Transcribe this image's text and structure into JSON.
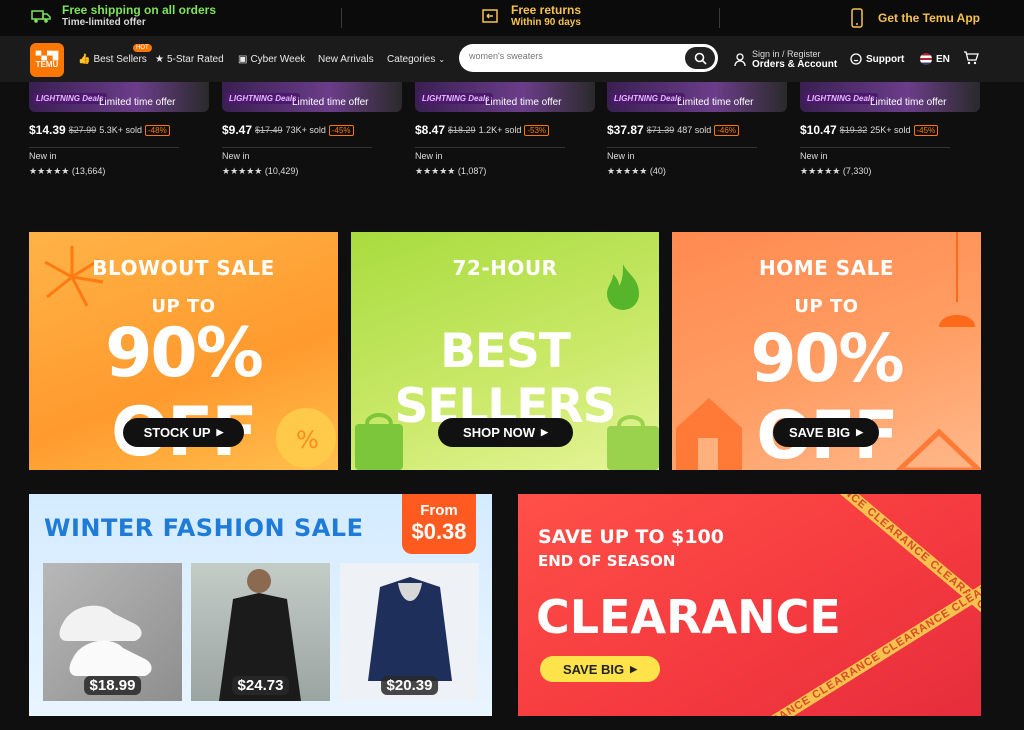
{
  "promo": {
    "shipping_title": "Free shipping on all orders",
    "shipping_sub": "Time-limited offer",
    "returns_title": "Free returns",
    "returns_sub": "Within 90 days",
    "app_label": "Get the Temu App"
  },
  "nav": {
    "logo_line1": "▀▄▀█",
    "logo_line2": "TEMU",
    "links": [
      "Best Sellers",
      "5-Star Rated",
      "Cyber Week",
      "New Arrivals",
      "Categories"
    ],
    "hot_badge": "HOT",
    "search_placeholder": "women's sweaters",
    "signin_line1": "Sign in / Register",
    "signin_line2": "Orders & Account",
    "support": "Support",
    "lang": "EN"
  },
  "products": [
    {
      "badge": "LIGHTNING Deals",
      "offer": "Limited time offer",
      "price": "$14.39",
      "orig": "$27.99",
      "sold": "5.3K+ sold",
      "disc": "-48%",
      "newin": "New in",
      "stars": "★★★★★",
      "reviews": "(13,664)"
    },
    {
      "badge": "LIGHTNING Deals",
      "offer": "Limited time offer",
      "price": "$9.47",
      "orig": "$17.49",
      "sold": "73K+ sold",
      "disc": "-45%",
      "newin": "New in",
      "stars": "★★★★★",
      "reviews": "(10,429)"
    },
    {
      "badge": "LIGHTNING Deals",
      "offer": "Limited time offer",
      "price": "$8.47",
      "orig": "$18.29",
      "sold": "1.2K+ sold",
      "disc": "-53%",
      "newin": "New in",
      "stars": "★★★★★",
      "reviews": "(1,087)"
    },
    {
      "badge": "LIGHTNING Deals",
      "offer": "Limited time offer",
      "price": "$37.87",
      "orig": "$71.39",
      "sold": "487 sold",
      "disc": "-46%",
      "newin": "New in",
      "stars": "★★★★★",
      "reviews": "(40)"
    },
    {
      "badge": "LIGHTNING Deals",
      "offer": "Limited time offer",
      "price": "$10.47",
      "orig": "$19.32",
      "sold": "25K+ sold",
      "disc": "-45%",
      "newin": "New in",
      "stars": "★★★★★",
      "reviews": "(7,330)"
    }
  ],
  "banners": {
    "blowout": {
      "line1": "BLOWOUT SALE",
      "line2": "UP TO",
      "line3": "90% OFF",
      "cta": "STOCK UP"
    },
    "bestsellers": {
      "line1": "72-HOUR",
      "line2": "BEST SELLERS",
      "cta": "SHOP NOW"
    },
    "home": {
      "line1": "HOME SALE",
      "line2": "UP TO",
      "line3": "90% OFF",
      "cta": "SAVE BIG"
    },
    "winter": {
      "title": "WINTER FASHION SALE",
      "from_label": "From",
      "from_price": "$0.38",
      "items": [
        "$18.99",
        "$24.73",
        "$20.39"
      ]
    },
    "clearance": {
      "line1": "SAVE UP TO $100",
      "line2": "END OF SEASON",
      "line3": "CLEARANCE",
      "cta": "SAVE BIG",
      "tape": "CLEARANCE CLEARANCE CLEARANCE CLEARANCE"
    }
  },
  "colors": {
    "brand": "#fb7701",
    "green": "#7fe35b"
  }
}
